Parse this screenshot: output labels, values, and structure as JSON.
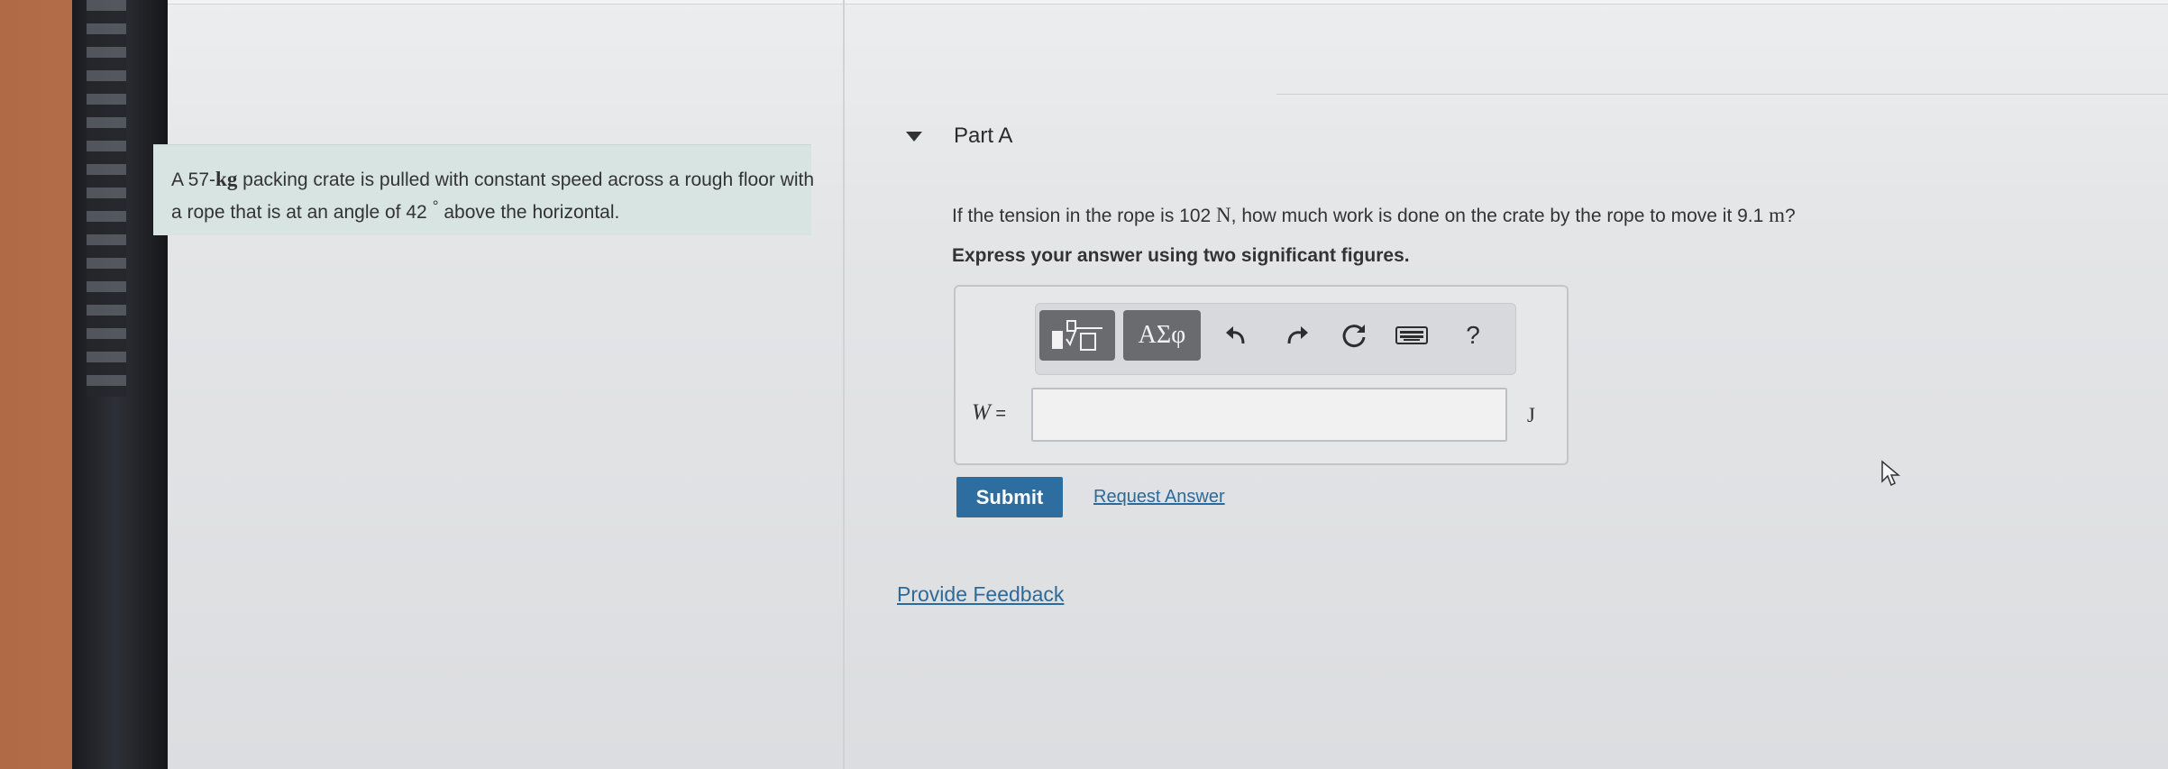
{
  "problem": {
    "text_before_mass": "A 57-",
    "mass_unit": "kg",
    "text_after_mass": " packing crate is pulled with constant speed across a rough floor with a rope that is at an angle of 42",
    "degree_symbol": "°",
    "text_end": " above the horizontal."
  },
  "part": {
    "title": "Part A",
    "question_before_tension": "If the tension in the rope is 102 ",
    "tension_unit": "N",
    "question_middle": ", how much work is done on the crate by the rope to move it 9.1 ",
    "distance_unit": "m",
    "question_end": "?",
    "instruction": "Express your answer using two significant figures."
  },
  "toolbar": {
    "templates_icon": "templates-icon",
    "greek_label": "ΑΣφ",
    "undo_icon": "undo-icon",
    "redo_icon": "redo-icon",
    "reset_icon": "reset-icon",
    "keyboard_icon": "keyboard-icon",
    "help_label": "?"
  },
  "answer": {
    "variable": "W",
    "equals": " =",
    "value": "",
    "unit": "J"
  },
  "actions": {
    "submit_label": "Submit",
    "request_answer_label": "Request Answer",
    "feedback_label": "Provide Feedback"
  },
  "colors": {
    "accent": "#2d6d9f",
    "link": "#2e6a98",
    "problem_bg": "#d8e4e1",
    "toolbar_button": "#6a6b6f"
  }
}
